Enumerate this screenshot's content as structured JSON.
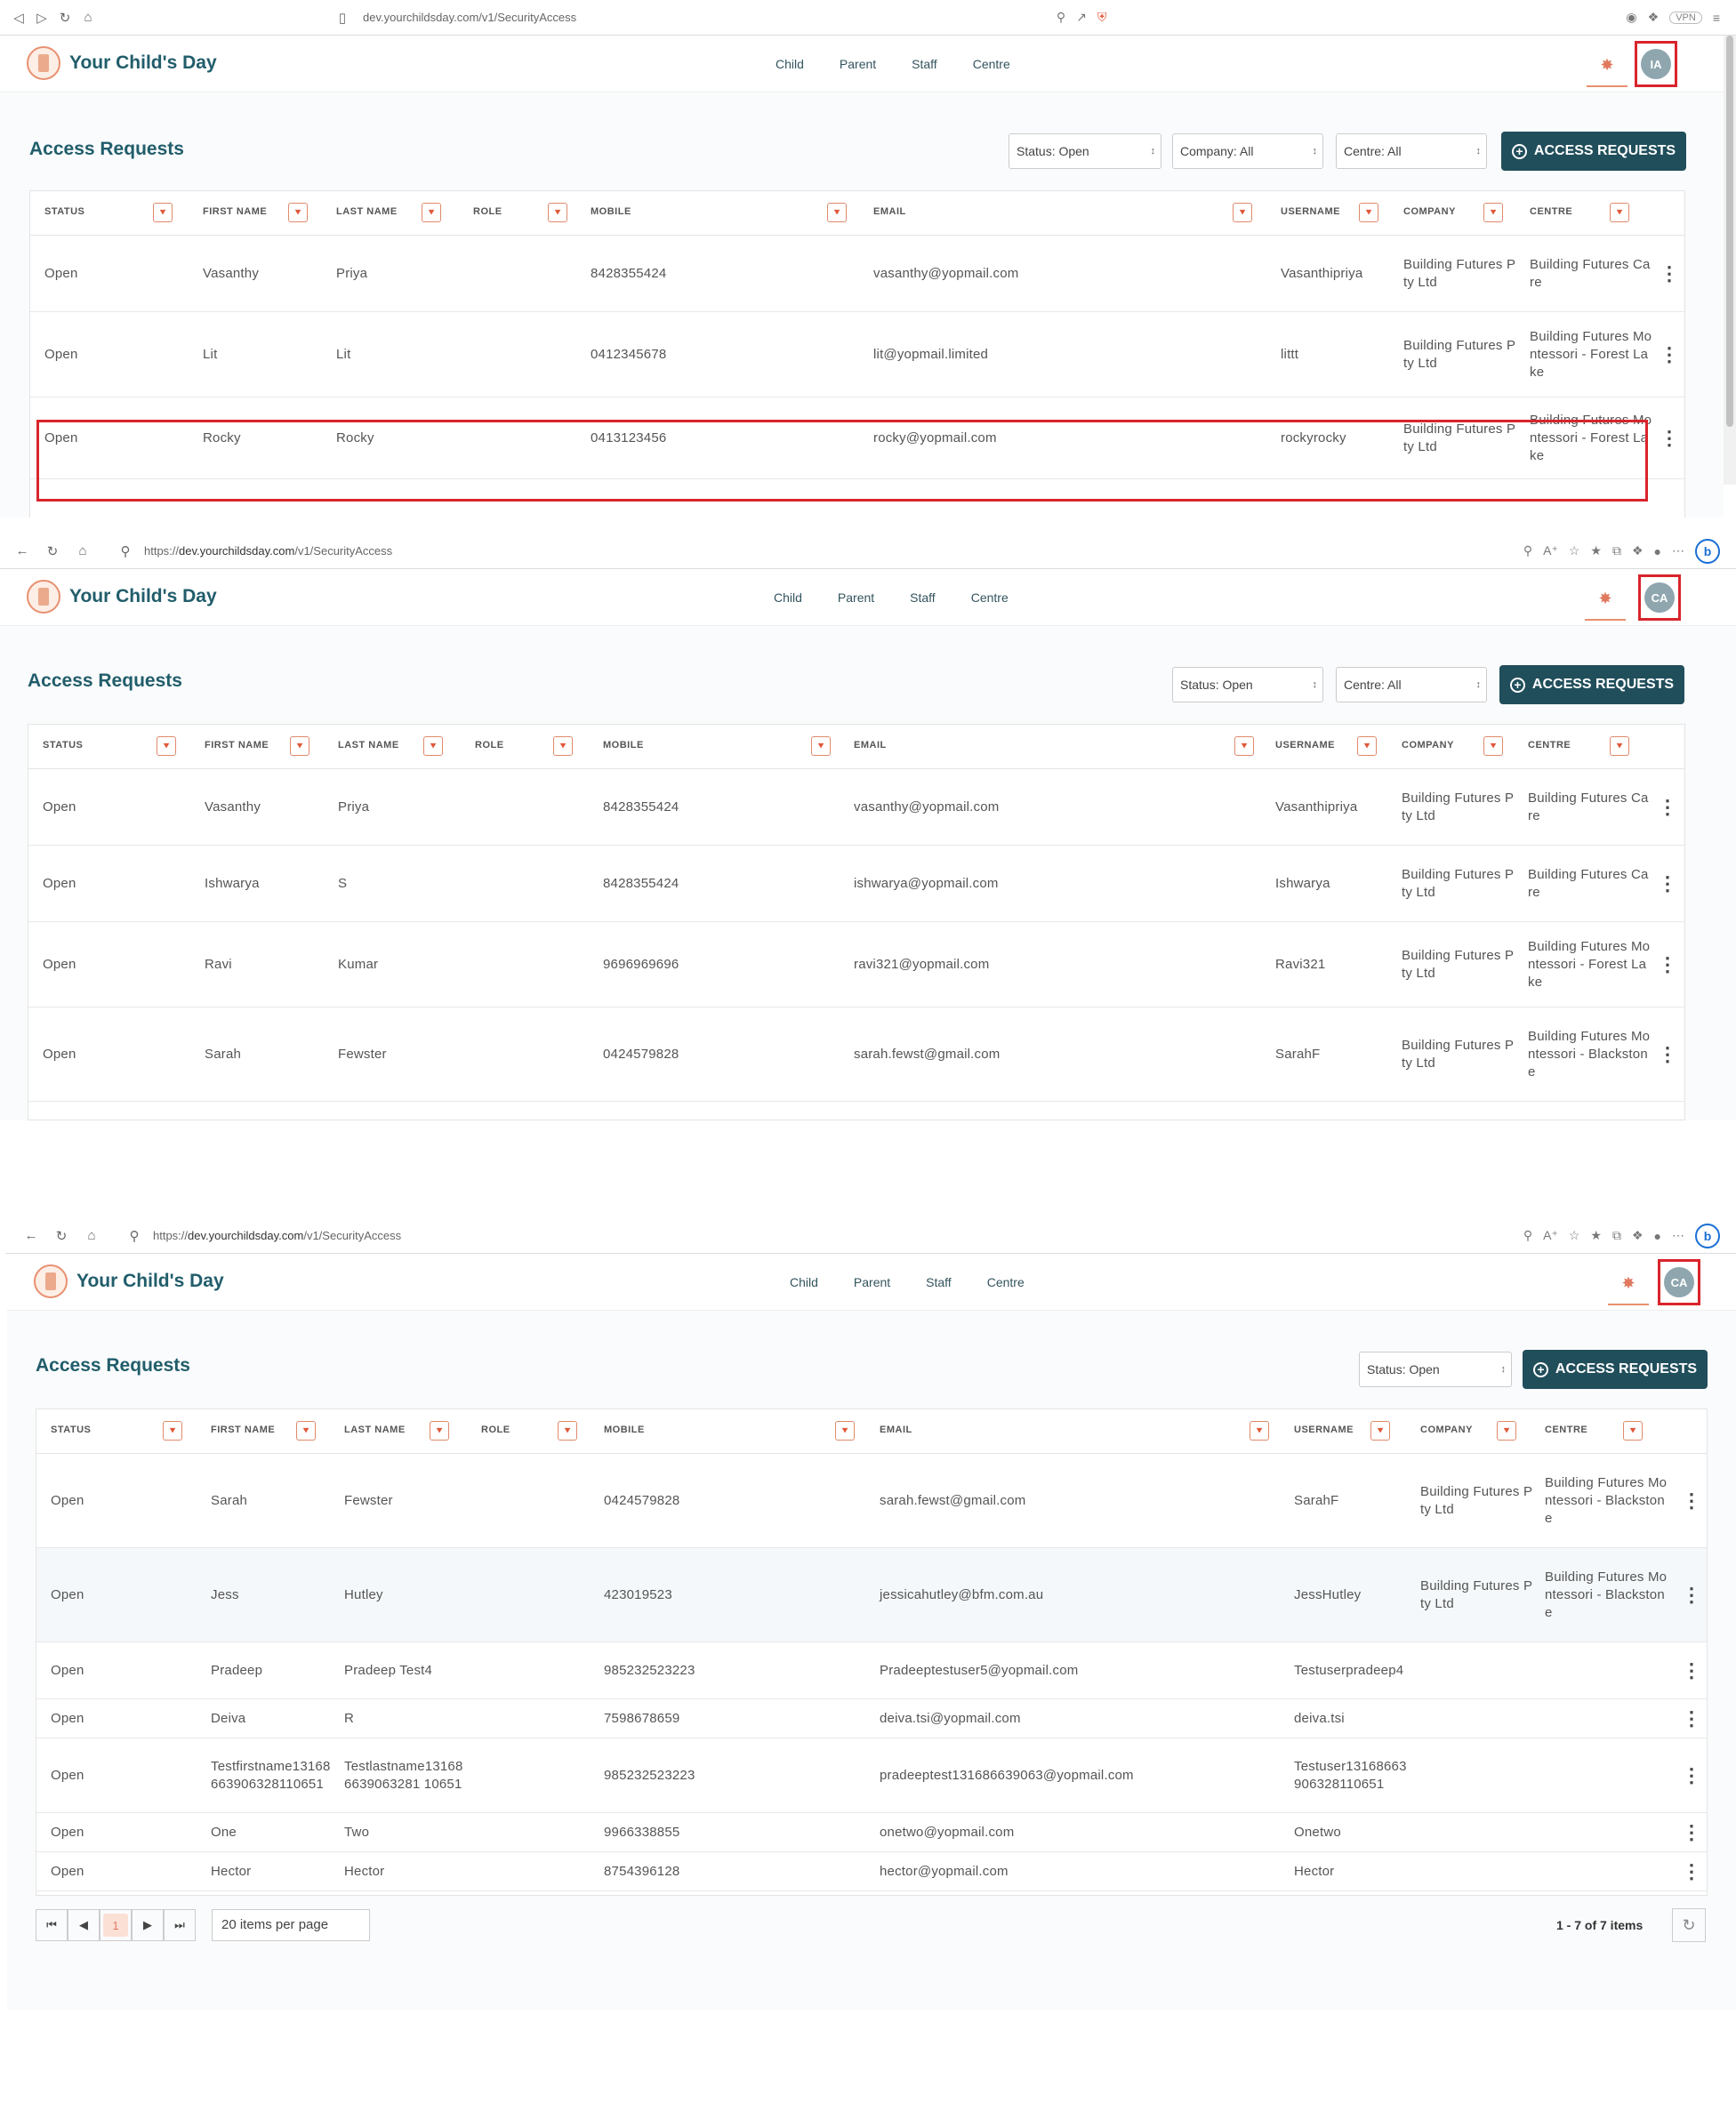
{
  "brand": {
    "title": "Your Child's Day"
  },
  "nav": [
    "Child",
    "Parent",
    "Staff",
    "Centre"
  ],
  "page": {
    "title": "Access Requests",
    "button": "ACCESS REQUESTS"
  },
  "columns": [
    "STATUS",
    "FIRST NAME",
    "LAST NAME",
    "ROLE",
    "MOBILE",
    "EMAIL",
    "USERNAME",
    "COMPANY",
    "CENTRE"
  ],
  "panel1": {
    "url": "dev.yourchildsday.com/v1/SecurityAccess",
    "vpn": "VPN",
    "avatar": "IA",
    "filters": [
      "Status: Open",
      "Company:  All",
      "Centre:  All"
    ],
    "rows": [
      {
        "status": "Open",
        "first": "Vasanthy",
        "last": "Priya",
        "mobile": "8428355424",
        "email": "vasanthy@yopmail.com",
        "username": "Vasanthipriya",
        "company": "Building Futures Pty Ltd",
        "centre": "Building Futures Care"
      },
      {
        "status": "Open",
        "first": "Lit",
        "last": "Lit",
        "mobile": "0412345678",
        "email": "lit@yopmail.limited",
        "username": "littt",
        "company": "Building Futures Pty Ltd",
        "centre": "Building Futures Montessori - Forest Lake"
      },
      {
        "status": "Open",
        "first": "Rocky",
        "last": "Rocky",
        "mobile": "0413123456",
        "email": "rocky@yopmail.com",
        "username": "rockyrocky",
        "company": "Building Futures Pty Ltd",
        "centre": "Building Futures Montessori - Forest Lake"
      }
    ]
  },
  "panel2": {
    "url_prefix": "https://",
    "url_host": "dev.yourchildsday.com",
    "url_path": "/v1/SecurityAccess",
    "avatar": "CA",
    "filters": [
      "Status: Open",
      "Centre:  All"
    ],
    "rows": [
      {
        "status": "Open",
        "first": "Vasanthy",
        "last": "Priya",
        "mobile": "8428355424",
        "email": "vasanthy@yopmail.com",
        "username": "Vasanthipriya",
        "company": "Building Futures Pty Ltd",
        "centre": "Building Futures Care"
      },
      {
        "status": "Open",
        "first": "Ishwarya",
        "last": "S",
        "mobile": "8428355424",
        "email": "ishwarya@yopmail.com",
        "username": "Ishwarya",
        "company": "Building Futures Pty Ltd",
        "centre": "Building Futures Care"
      },
      {
        "status": "Open",
        "first": "Ravi",
        "last": "Kumar",
        "mobile": "9696969696",
        "email": "ravi321@yopmail.com",
        "username": "Ravi321",
        "company": "Building Futures Pty Ltd",
        "centre": "Building Futures Montessori - Forest Lake"
      },
      {
        "status": "Open",
        "first": "Sarah",
        "last": "Fewster",
        "mobile": "0424579828",
        "email": "sarah.fewst@gmail.com",
        "username": "SarahF",
        "company": "Building Futures Pty Ltd",
        "centre": "Building Futures Montessori - Blackstone"
      }
    ]
  },
  "panel3": {
    "url_prefix": "https://",
    "url_host": "dev.yourchildsday.com",
    "url_path": "/v1/SecurityAccess",
    "avatar": "CA",
    "filters": [
      "Status: Open"
    ],
    "rows": [
      {
        "status": "Open",
        "first": "Sarah",
        "last": "Fewster",
        "mobile": "0424579828",
        "email": "sarah.fewst@gmail.com",
        "username": "SarahF",
        "company": "Building Futures Pty Ltd",
        "centre": "Building Futures Montessori - Blackstone"
      },
      {
        "status": "Open",
        "first": "Jess",
        "last": "Hutley",
        "mobile": "423019523",
        "email": "jessicahutley@bfm.com.au",
        "username": "JessHutley",
        "company": "Building Futures Pty Ltd",
        "centre": "Building Futures Montessori - Blackstone"
      },
      {
        "status": "Open",
        "first": "Pradeep",
        "last": "Pradeep Test4",
        "mobile": "985232523223",
        "email": "Pradeeptestuser5@yopmail.com",
        "username": "Testuserpradeep4",
        "company": "",
        "centre": ""
      },
      {
        "status": "Open",
        "first": "Deiva",
        "last": "R",
        "mobile": "7598678659",
        "email": "deiva.tsi@yopmail.com",
        "username": "deiva.tsi",
        "company": "",
        "centre": ""
      },
      {
        "status": "Open",
        "first": "Testfirstname13168663906328110651",
        "last": "Testlastname131686639063281 10651",
        "mobile": "985232523223",
        "email": "pradeeptest131686639063@yopmail.com",
        "username": "Testuser13168663906328110651",
        "company": "",
        "centre": ""
      },
      {
        "status": "Open",
        "first": "One",
        "last": "Two",
        "mobile": "9966338855",
        "email": "onetwo@yopmail.com",
        "username": "Onetwo",
        "company": "",
        "centre": ""
      },
      {
        "status": "Open",
        "first": "Hector",
        "last": "Hector",
        "mobile": "8754396128",
        "email": "hector@yopmail.com",
        "username": "Hector",
        "company": "",
        "centre": ""
      }
    ],
    "pager": {
      "page": "1",
      "items_per_page": "20 items per page",
      "count": "1 - 7 of 7 items"
    }
  }
}
